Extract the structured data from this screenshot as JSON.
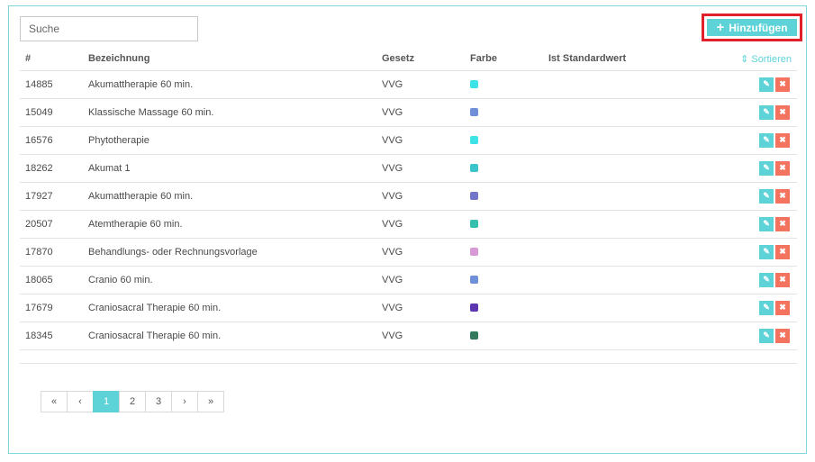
{
  "search": {
    "placeholder": "Suche",
    "value": ""
  },
  "toolbar": {
    "add_label": "Hinzufügen",
    "add_icon": "plus-icon"
  },
  "table": {
    "headers": {
      "id": "#",
      "name": "Bezeichnung",
      "law": "Gesetz",
      "color": "Farbe",
      "default": "Ist Standardwert",
      "sort": "⇕ Sortieren"
    },
    "rows": [
      {
        "id": "14885",
        "name": "Akumattherapie 60 min.",
        "law": "VVG",
        "color": "#3ee3e8",
        "default": ""
      },
      {
        "id": "15049",
        "name": "Klassische Massage 60 min.",
        "law": "VVG",
        "color": "#6f8fd8",
        "default": ""
      },
      {
        "id": "16576",
        "name": "Phytotherapie",
        "law": "VVG",
        "color": "#3ee3e8",
        "default": ""
      },
      {
        "id": "18262",
        "name": "Akumat 1",
        "law": "VVG",
        "color": "#3cc3cc",
        "default": ""
      },
      {
        "id": "17927",
        "name": "Akumattherapie 60 min.",
        "law": "VVG",
        "color": "#7276c8",
        "default": ""
      },
      {
        "id": "20507",
        "name": "Atemtherapie 60 min.",
        "law": "VVG",
        "color": "#35bfae",
        "default": ""
      },
      {
        "id": "17870",
        "name": "Behandlungs- oder Rechnungsvorlage",
        "law": "VVG",
        "color": "#d89ad6",
        "default": ""
      },
      {
        "id": "18065",
        "name": "Cranio 60 min.",
        "law": "VVG",
        "color": "#6f8fd8",
        "default": ""
      },
      {
        "id": "17679",
        "name": "Craniosacral Therapie 60 min.",
        "law": "VVG",
        "color": "#5b36b0",
        "default": ""
      },
      {
        "id": "18345",
        "name": "Craniosacral Therapie 60 min.",
        "law": "VVG",
        "color": "#357a5e",
        "default": ""
      }
    ],
    "action_icons": {
      "edit": "edit-icon",
      "delete": "close-icon"
    }
  },
  "pagination": {
    "first": "«",
    "prev": "‹",
    "pages": [
      "1",
      "2",
      "3"
    ],
    "current": "1",
    "next": "›",
    "last": "»"
  },
  "colors": {
    "accent": "#5dd3d8",
    "delete": "#f4735f",
    "highlight": "#e0202a"
  }
}
